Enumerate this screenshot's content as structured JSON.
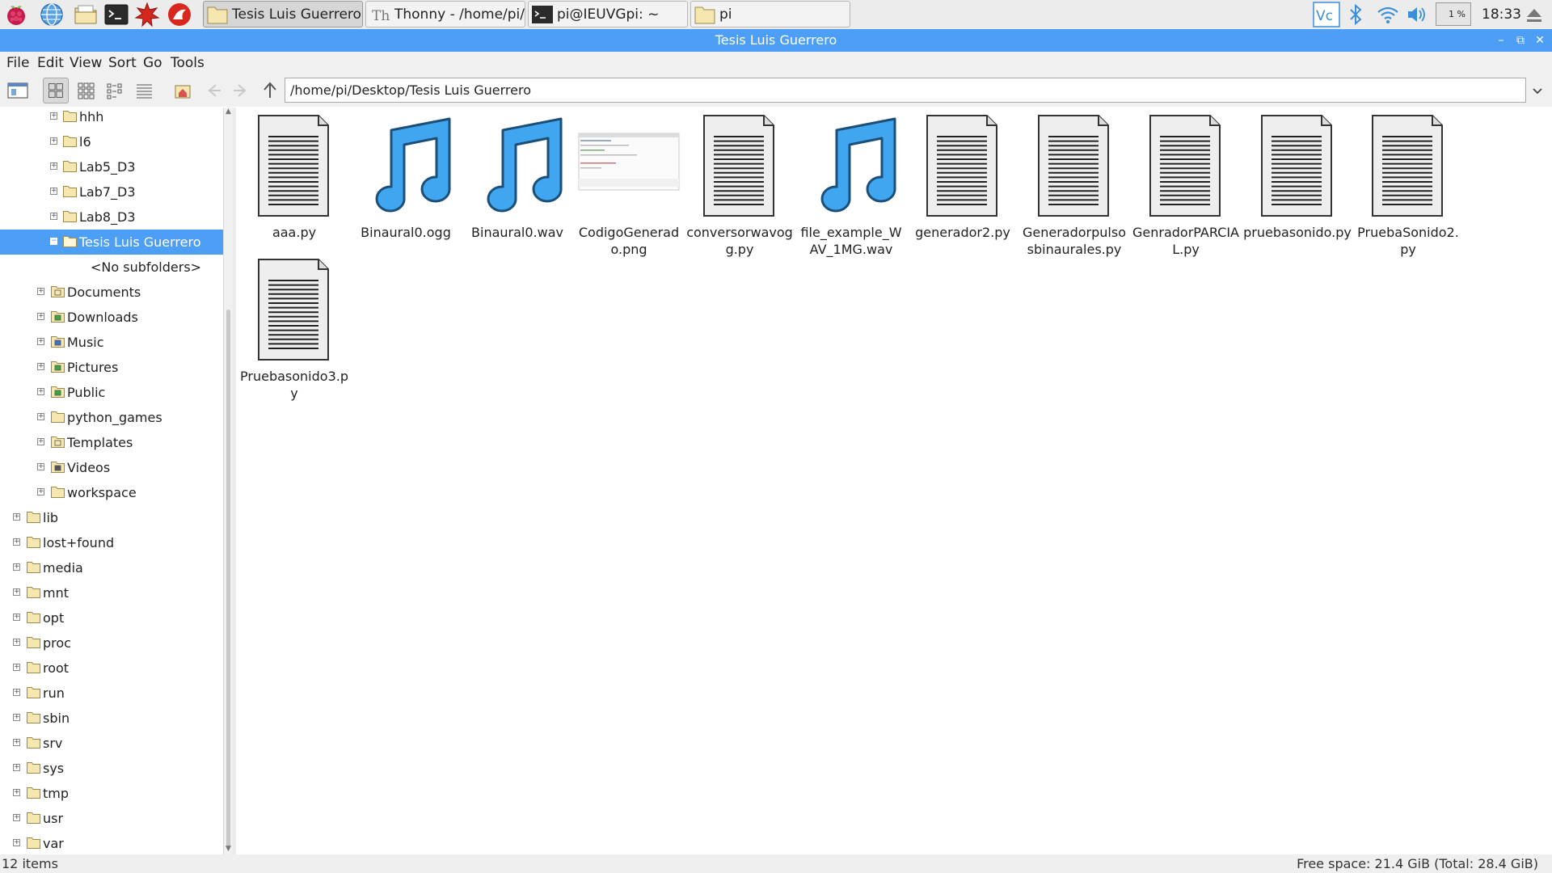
{
  "taskbar": {
    "tasks": [
      {
        "label": "Tesis Luis Guerrero",
        "icon": "folder-icon"
      },
      {
        "label": "Thonny  -  /home/pi/...",
        "icon": "thonny-icon"
      },
      {
        "label": "pi@IEUVGpi: ~",
        "icon": "terminal-icon"
      },
      {
        "label": "pi",
        "icon": "folder-icon"
      }
    ],
    "cpu": "1 %",
    "clock": "18:33"
  },
  "window": {
    "title": "Tesis Luis Guerrero"
  },
  "menu": {
    "file": "File",
    "edit": "Edit",
    "view": "View",
    "sort": "Sort",
    "go": "Go",
    "tools": "Tools"
  },
  "toolbar": {
    "path": "/home/pi/Desktop/Tesis Luis Guerrero"
  },
  "sidebar": {
    "items": [
      {
        "label": "hhh"
      },
      {
        "label": "l6"
      },
      {
        "label": "Lab5_D3"
      },
      {
        "label": "Lab7_D3"
      },
      {
        "label": "Lab8_D3"
      },
      {
        "label": "Tesis Luis Guerrero"
      },
      {
        "label": "<No subfolders>"
      },
      {
        "label": "Documents"
      },
      {
        "label": "Downloads"
      },
      {
        "label": "Music"
      },
      {
        "label": "Pictures"
      },
      {
        "label": "Public"
      },
      {
        "label": "python_games"
      },
      {
        "label": "Templates"
      },
      {
        "label": "Videos"
      },
      {
        "label": "workspace"
      },
      {
        "label": "lib"
      },
      {
        "label": "lost+found"
      },
      {
        "label": "media"
      },
      {
        "label": "mnt"
      },
      {
        "label": "opt"
      },
      {
        "label": "proc"
      },
      {
        "label": "root"
      },
      {
        "label": "run"
      },
      {
        "label": "sbin"
      },
      {
        "label": "srv"
      },
      {
        "label": "sys"
      },
      {
        "label": "tmp"
      },
      {
        "label": "usr"
      },
      {
        "label": "var"
      }
    ]
  },
  "files": [
    {
      "name": "aaa.py",
      "type": "text-file-icon"
    },
    {
      "name": "Binaural0.ogg",
      "type": "music-note-icon"
    },
    {
      "name": "Binaural0.wav",
      "type": "music-note-icon"
    },
    {
      "name": "CodigoGenerado.png",
      "type": "image-thumbnail"
    },
    {
      "name": "conversorwavogg.py",
      "type": "text-file-icon"
    },
    {
      "name": "file_example_WAV_1MG.wav",
      "type": "music-note-icon"
    },
    {
      "name": "generador2.py",
      "type": "text-file-icon"
    },
    {
      "name": "Generadorpulsosbinaurales.py",
      "type": "text-file-icon"
    },
    {
      "name": "GenradorPARCIAL.py",
      "type": "text-file-icon"
    },
    {
      "name": "pruebasonido.py",
      "type": "text-file-icon"
    },
    {
      "name": "PruebaSonido2.py",
      "type": "text-file-icon"
    },
    {
      "name": "Pruebasonido3.py",
      "type": "text-file-icon"
    }
  ],
  "status": {
    "count": "12 items",
    "free": "Free space: 21.4 GiB (Total: 28.4 GiB)"
  },
  "colors": {
    "accent": "#4d9ef5",
    "music_icon": "#3fa6ef",
    "folder": "#f6e7b0"
  }
}
